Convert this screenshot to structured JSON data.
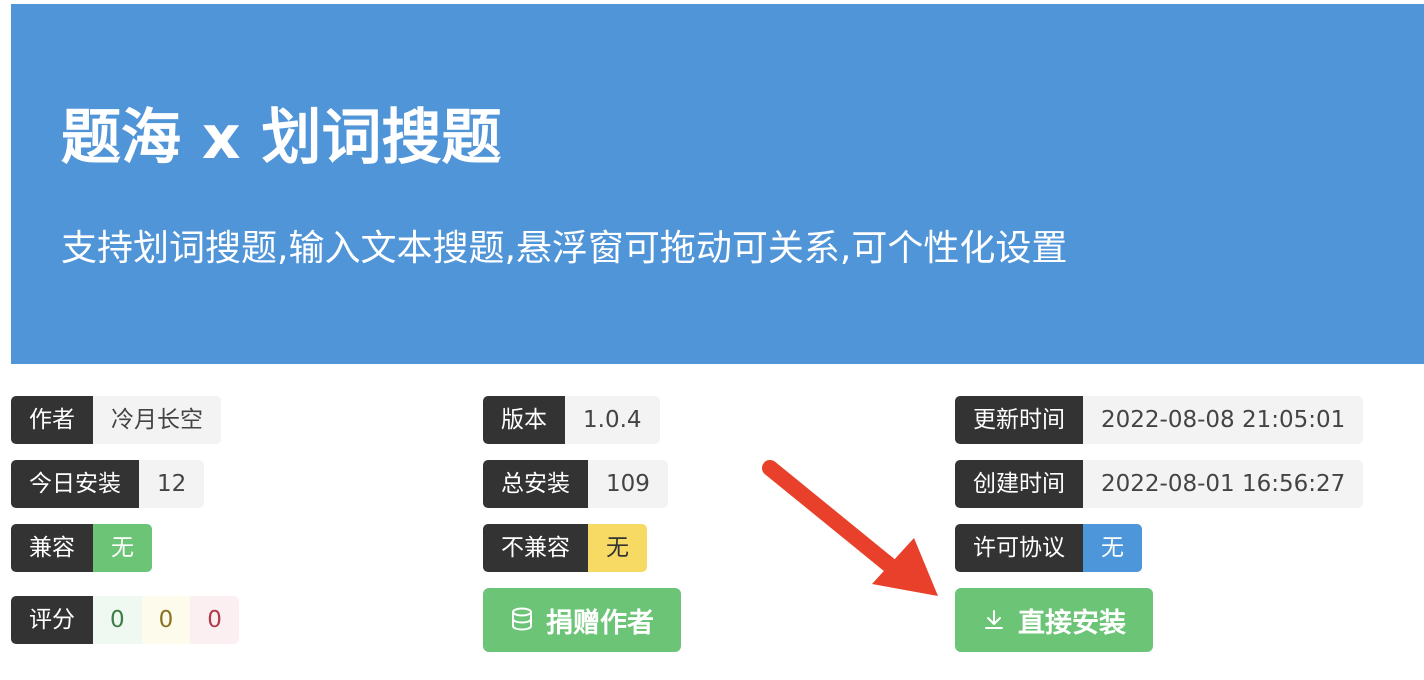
{
  "header": {
    "title": "题海 x 划词搜题",
    "subtitle": "支持划词搜题,输入文本搜题,悬浮窗可拖动可关系,可个性化设置",
    "background_color": "#5095d8"
  },
  "info": {
    "author": {
      "label": "作者",
      "value": "冷月长空"
    },
    "today_installs": {
      "label": "今日安装",
      "value": "12"
    },
    "compatible": {
      "label": "兼容",
      "value": "无"
    },
    "rating": {
      "label": "评分",
      "good": "0",
      "ok": "0",
      "bad": "0"
    },
    "version": {
      "label": "版本",
      "value": "1.0.4"
    },
    "total_installs": {
      "label": "总安装",
      "value": "109"
    },
    "incompatible": {
      "label": "不兼容",
      "value": "无"
    },
    "updated": {
      "label": "更新时间",
      "value": "2022-08-08 21:05:01"
    },
    "created": {
      "label": "创建时间",
      "value": "2022-08-01 16:56:27"
    },
    "license": {
      "label": "许可协议",
      "value": "无"
    }
  },
  "actions": {
    "donate_label": "捐赠作者",
    "donate_icon": "coins-icon",
    "install_label": "直接安装",
    "install_icon": "download-icon"
  },
  "colors": {
    "label_bg": "#333333",
    "value_bg": "#f3f3f3",
    "green": "#6cc477",
    "yellow": "#f7da63",
    "blue": "#4d96d9",
    "arrow": "#e8402a"
  }
}
